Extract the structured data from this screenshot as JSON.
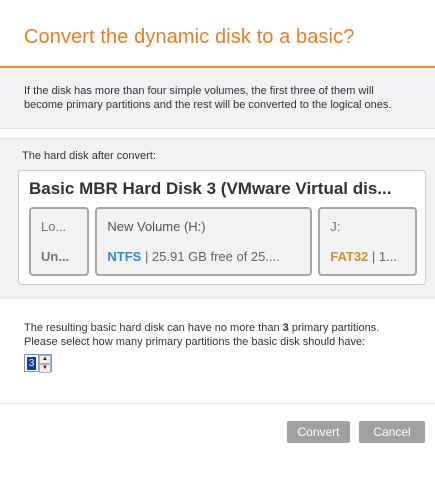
{
  "dialog": {
    "title": "Convert the dynamic disk to a basic?",
    "intro": "If the disk has more than four simple volumes, the first three of them will become primary partitions and the rest will be converted to the logical ones."
  },
  "disk_panel": {
    "label": "The hard disk after convert:",
    "disk_title": "Basic MBR Hard Disk 3 (VMware Virtual dis...",
    "partitions": [
      {
        "name": "Lo...",
        "fs": "",
        "info": "Un..."
      },
      {
        "name": "New Volume (H:)",
        "fs": "NTFS",
        "info": " | 25.91 GB free of 25...."
      },
      {
        "name": "J:",
        "fs": "FAT32",
        "info": " | 1..."
      }
    ]
  },
  "question": {
    "text_before": "The resulting basic hard disk can have no more than ",
    "max_number": "3",
    "text_after": " primary partitions. Please select how many primary partitions the basic disk should have:",
    "spinner_value": "3",
    "spin_up": "▲",
    "spin_down": "▼"
  },
  "footer": {
    "convert_label": "Convert",
    "cancel_label": "Cancel"
  },
  "colors": {
    "accent": "#ec7c22",
    "ntfs": "#2c8fc9",
    "fat32": "#c9962a",
    "button": "#a0a0a0"
  }
}
